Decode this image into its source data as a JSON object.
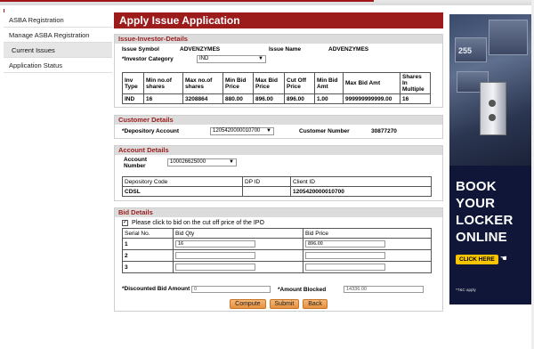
{
  "nav": {
    "items": [
      "ASBA Registration",
      "Manage ASBA Registration",
      "Current Issues",
      "Application Status"
    ]
  },
  "page": {
    "title": "Apply Issue Application"
  },
  "issue_investor": {
    "header": "Issue-Investor-Details",
    "symbol_label": "Issue Symbol",
    "symbol_value": "ADVENZYMES",
    "name_label": "Issue Name",
    "name_value": "ADVENZYMES",
    "category_label": "*Investor Category",
    "category_value": "IND",
    "table": {
      "headers": [
        "Inv Type",
        "Min no.of shares",
        "Max no.of shares",
        "Min Bid Price",
        "Max Bid Price",
        "Cut Off Price",
        "Min Bid Amt",
        "Max Bid Amt",
        "Shares In Multiple"
      ],
      "row": [
        "IND",
        "16",
        "3208864",
        "880.00",
        "896.00",
        "896.00",
        "1.00",
        "999999999999.00",
        "16"
      ]
    }
  },
  "customer": {
    "header": "Customer Details",
    "dp_label": "*Depository Account",
    "dp_value": "1205420000010700",
    "number_label": "Customer Number",
    "number_value": "30877270"
  },
  "account": {
    "header": "Account Details",
    "number_label": "Account Number",
    "number_value": "100026625000",
    "table": {
      "headers": [
        "Depository Code",
        "DP ID",
        "Client ID"
      ],
      "row": [
        "CDSL",
        "",
        "1205420000010700"
      ]
    }
  },
  "bid": {
    "header": "Bid Details",
    "cutoff_label": "Please click to bid on the cut off price of the IPO",
    "col_serial": "Serial No.",
    "col_qty": "Bid Qty",
    "col_price": "Bid Price",
    "rows": [
      {
        "serial": "1",
        "qty": "16",
        "price": "896.00"
      },
      {
        "serial": "2",
        "qty": "",
        "price": ""
      },
      {
        "serial": "3",
        "qty": "",
        "price": ""
      }
    ],
    "discounted_label": "*Discounted Bid Amount",
    "discounted_value": "0",
    "blocked_label": "*Amount Blocked",
    "blocked_value": "14336.00"
  },
  "buttons": {
    "compute": "Compute",
    "submit": "Submit",
    "back": "Back"
  },
  "ad": {
    "locker_number": "255",
    "headline": [
      "BOOK",
      "YOUR",
      "LOCKER",
      "ONLINE"
    ],
    "cta": "CLICK HERE",
    "tc": "*T&C apply"
  },
  "colors": {
    "brand_red": "#9c1c1c",
    "ad_navy": "#0f1638",
    "cta_yellow": "#f6c400",
    "button_orange": "#e8913f"
  }
}
